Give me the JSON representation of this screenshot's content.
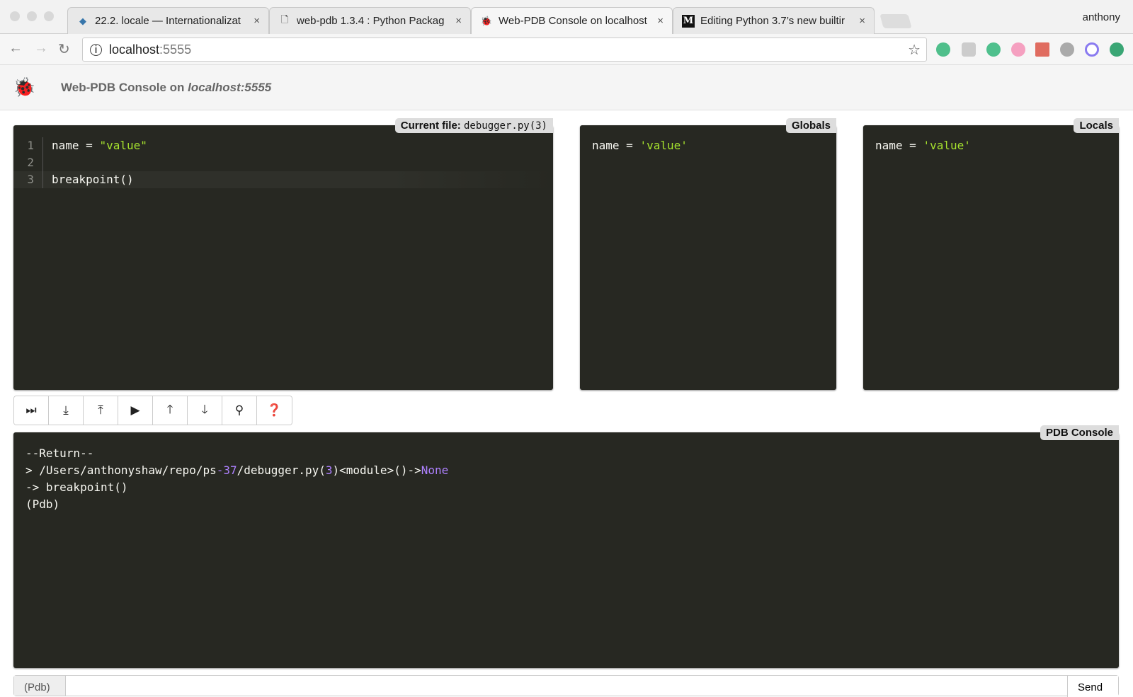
{
  "browser": {
    "tabs": [
      {
        "title": "22.2. locale — Internationalizat",
        "icon": "python-icon"
      },
      {
        "title": "web-pdb 1.3.4 : Python Packag",
        "icon": "document-icon"
      },
      {
        "title": "Web-PDB Console on localhost",
        "icon": "bug-icon"
      },
      {
        "title": "Editing Python 3.7’s new builtir",
        "icon": "medium-icon"
      }
    ],
    "close": "×",
    "user": "anthony",
    "url_host": "localhost",
    "url_port": ":5555",
    "extension_colors": [
      "#4fbf8b",
      "#bbbbbb",
      "#4fc08d",
      "#f5a0c0",
      "#e06c60",
      "#999999",
      "#8a7bf0",
      "#3aa675"
    ]
  },
  "header": {
    "title": "Web-PDB Console on ",
    "host": "localhost:5555"
  },
  "editor": {
    "label": "Current file:",
    "file": "debugger.py(3)",
    "lines": [
      {
        "n": "1",
        "pre": "name = ",
        "str": "\"value\""
      },
      {
        "n": "2",
        "pre": "",
        "str": ""
      },
      {
        "n": "3",
        "pre": "breakpoint()",
        "str": ""
      }
    ]
  },
  "globals": {
    "label": "Globals",
    "pre": "name = ",
    "str": "'value'"
  },
  "locals": {
    "label": "Locals",
    "pre": "name = ",
    "str": "'value'"
  },
  "toolbar": {
    "buttons": [
      {
        "name": "next-button",
        "glyph": "⏭︎"
      },
      {
        "name": "step-button",
        "glyph": "⤓"
      },
      {
        "name": "return-button",
        "glyph": "⤒"
      },
      {
        "name": "continue-button",
        "glyph": "▶"
      },
      {
        "name": "up-button",
        "glyph": "🡑"
      },
      {
        "name": "down-button",
        "glyph": "🡓"
      },
      {
        "name": "breakpoint-button",
        "glyph": "⚲"
      },
      {
        "name": "help-button",
        "glyph": "❓"
      }
    ]
  },
  "console": {
    "label": "PDB Console",
    "l1": "--Return--",
    "l2a": "> /Users/anthonyshaw/repo/ps",
    "l2b": "-37",
    "l2c": "/debugger.py(",
    "l2d": "3",
    "l2e": ")<module>()->",
    "l2f": "None",
    "l3": "-> breakpoint()",
    "l4": "(Pdb)"
  },
  "input": {
    "prefix": "(Pdb)",
    "send": "Send",
    "value": ""
  }
}
